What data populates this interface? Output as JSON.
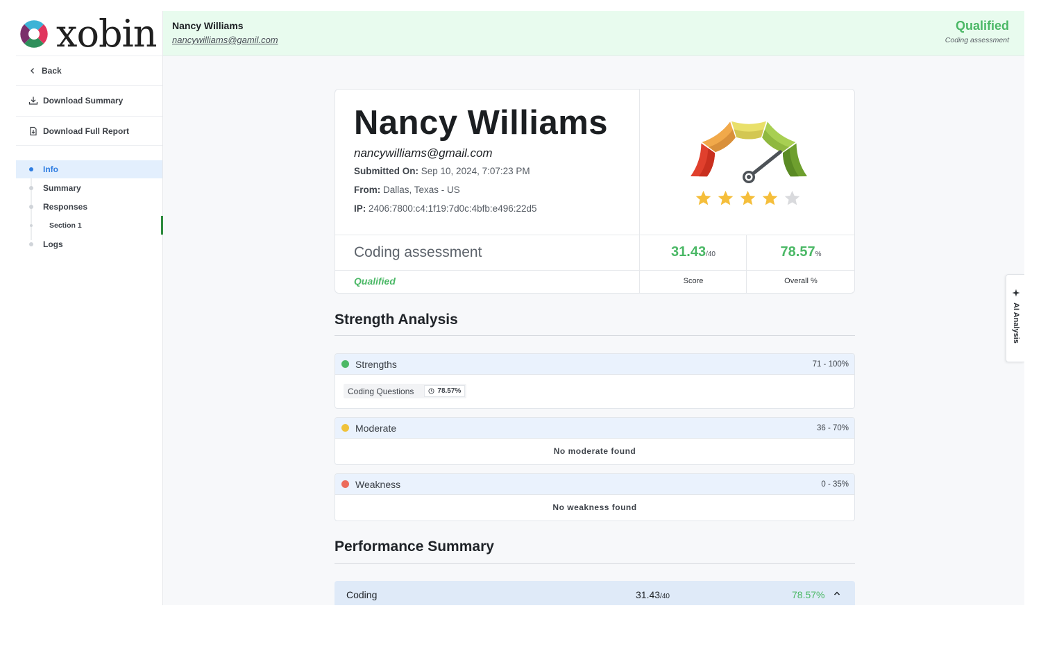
{
  "brand": {
    "logo_text": "xobin"
  },
  "sidebar": {
    "back_label": "Back",
    "download_summary_label": "Download Summary",
    "download_report_label": "Download Full Report",
    "nav": [
      {
        "label": "Info",
        "active": true
      },
      {
        "label": "Summary"
      },
      {
        "label": "Responses"
      },
      {
        "label": "Section 1",
        "sub": true
      },
      {
        "label": "Logs"
      }
    ]
  },
  "header": {
    "name": "Nancy Williams",
    "email": "nancywilliams@gamil.com",
    "status": "Qualified",
    "status_sub": "Coding assessment"
  },
  "candidate": {
    "name": "Nancy Williams",
    "email": "nancywilliams@gmail.com",
    "submitted_label": "Submitted On:",
    "submitted_value": "Sep 10, 2024, 7:07:23 PM",
    "from_label": "From:",
    "from_value": "Dallas, Texas - US",
    "ip_label": "IP:",
    "ip_value": "2406:7800:c4:1f19:7d0c:4bfb:e496:22d5",
    "rating_stars": 4,
    "rating_max": 5
  },
  "assessment": {
    "title": "Coding assessment",
    "status": "Qualified",
    "score": "31.43",
    "score_max": "/40",
    "score_label": "Score",
    "overall": "78.57",
    "overall_unit": "%",
    "overall_label": "Overall %"
  },
  "strength_analysis": {
    "title": "Strength Analysis",
    "groups": [
      {
        "label": "Strengths",
        "range": "71 - 100%",
        "color": "#4bb866",
        "chip_label": "Coding Questions",
        "chip_value": "78.57%"
      },
      {
        "label": "Moderate",
        "range": "36 - 70%",
        "color": "#f0c23a",
        "empty_text": "No moderate found"
      },
      {
        "label": "Weakness",
        "range": "0 - 35%",
        "color": "#ec6b5b",
        "empty_text": "No weakness found"
      }
    ]
  },
  "performance": {
    "title": "Performance Summary",
    "row_label": "Coding",
    "row_score": "31.43",
    "row_max": "/40",
    "row_pct": "78.57%"
  },
  "ai_tab_label": "AI Analysis",
  "colors": {
    "accent_green": "#4bb866",
    "accent_blue": "#2f7de1",
    "header_bg": "#e8fbee"
  }
}
